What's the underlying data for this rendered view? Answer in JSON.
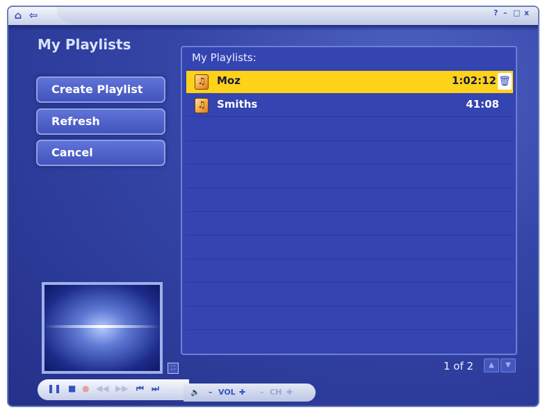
{
  "app": {
    "title": "My Playlists"
  },
  "topbar": {
    "home_icon": "home-icon",
    "back_icon": "back-arrow-icon",
    "help_label": "?",
    "minimize_label": "–",
    "maximize_label": "□",
    "close_label": "x"
  },
  "menu": {
    "items": [
      {
        "label": "Create Playlist"
      },
      {
        "label": "Refresh"
      },
      {
        "label": "Cancel"
      }
    ]
  },
  "playlists": {
    "header": "My Playlists:",
    "rows": [
      {
        "name": "Moz",
        "duration": "1:02:12",
        "selected": true
      },
      {
        "name": "Smiths",
        "duration": "41:08",
        "selected": false
      }
    ]
  },
  "pager": {
    "text": "1 of 2"
  },
  "transport": {
    "vol_label": "VOL",
    "ch_label": "CH"
  },
  "colors": {
    "background": "#3546a8",
    "selection": "#ffd21a",
    "panel": "#3444b0"
  }
}
